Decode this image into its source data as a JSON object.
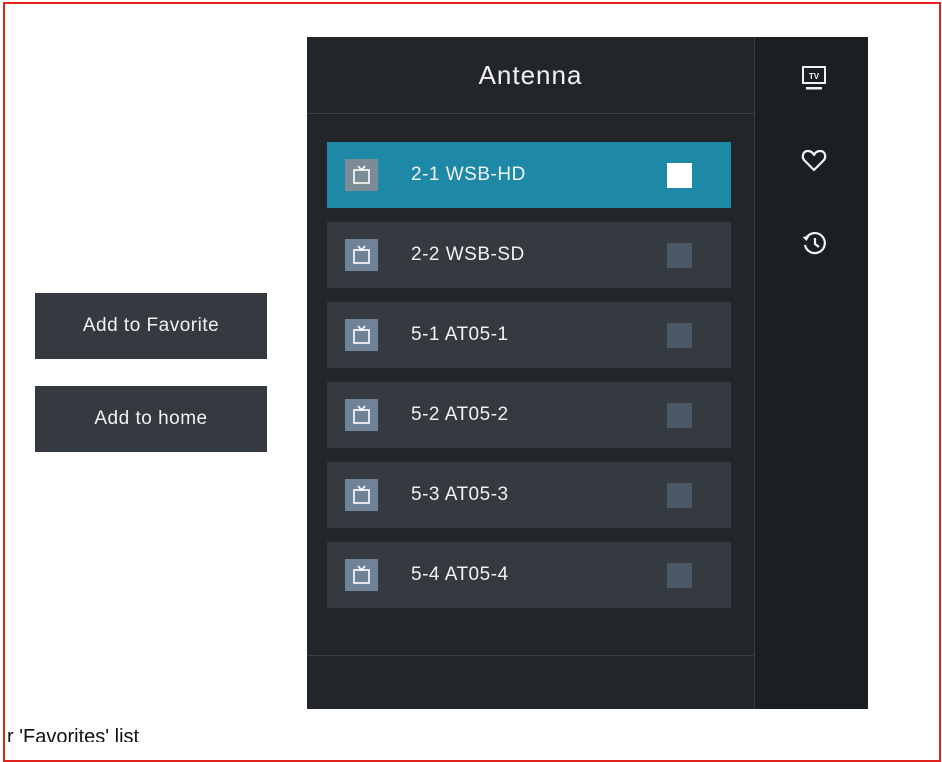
{
  "panel": {
    "title": "Antenna"
  },
  "channels": [
    {
      "label": "2-1 WSB-HD",
      "selected": true,
      "checked": true
    },
    {
      "label": "2-2 WSB-SD",
      "selected": false,
      "checked": false
    },
    {
      "label": "5-1 AT05-1",
      "selected": false,
      "checked": false
    },
    {
      "label": "5-2 AT05-2",
      "selected": false,
      "checked": false
    },
    {
      "label": "5-3 AT05-3",
      "selected": false,
      "checked": false
    },
    {
      "label": "5-4 AT05-4",
      "selected": false,
      "checked": false
    }
  ],
  "actions": {
    "add_to_favorite": "Add to Favorite",
    "add_to_home": "Add to home"
  },
  "side_nav": {
    "tv_icon_text": "TV",
    "icons": [
      "tv-icon",
      "heart-icon",
      "history-icon"
    ]
  },
  "caption": "r 'Favorites' list",
  "colors": {
    "accent": "#1d89a6",
    "frame_border": "#e0231c",
    "panel_bg": "#22262a",
    "item_bg": "#343a40"
  }
}
